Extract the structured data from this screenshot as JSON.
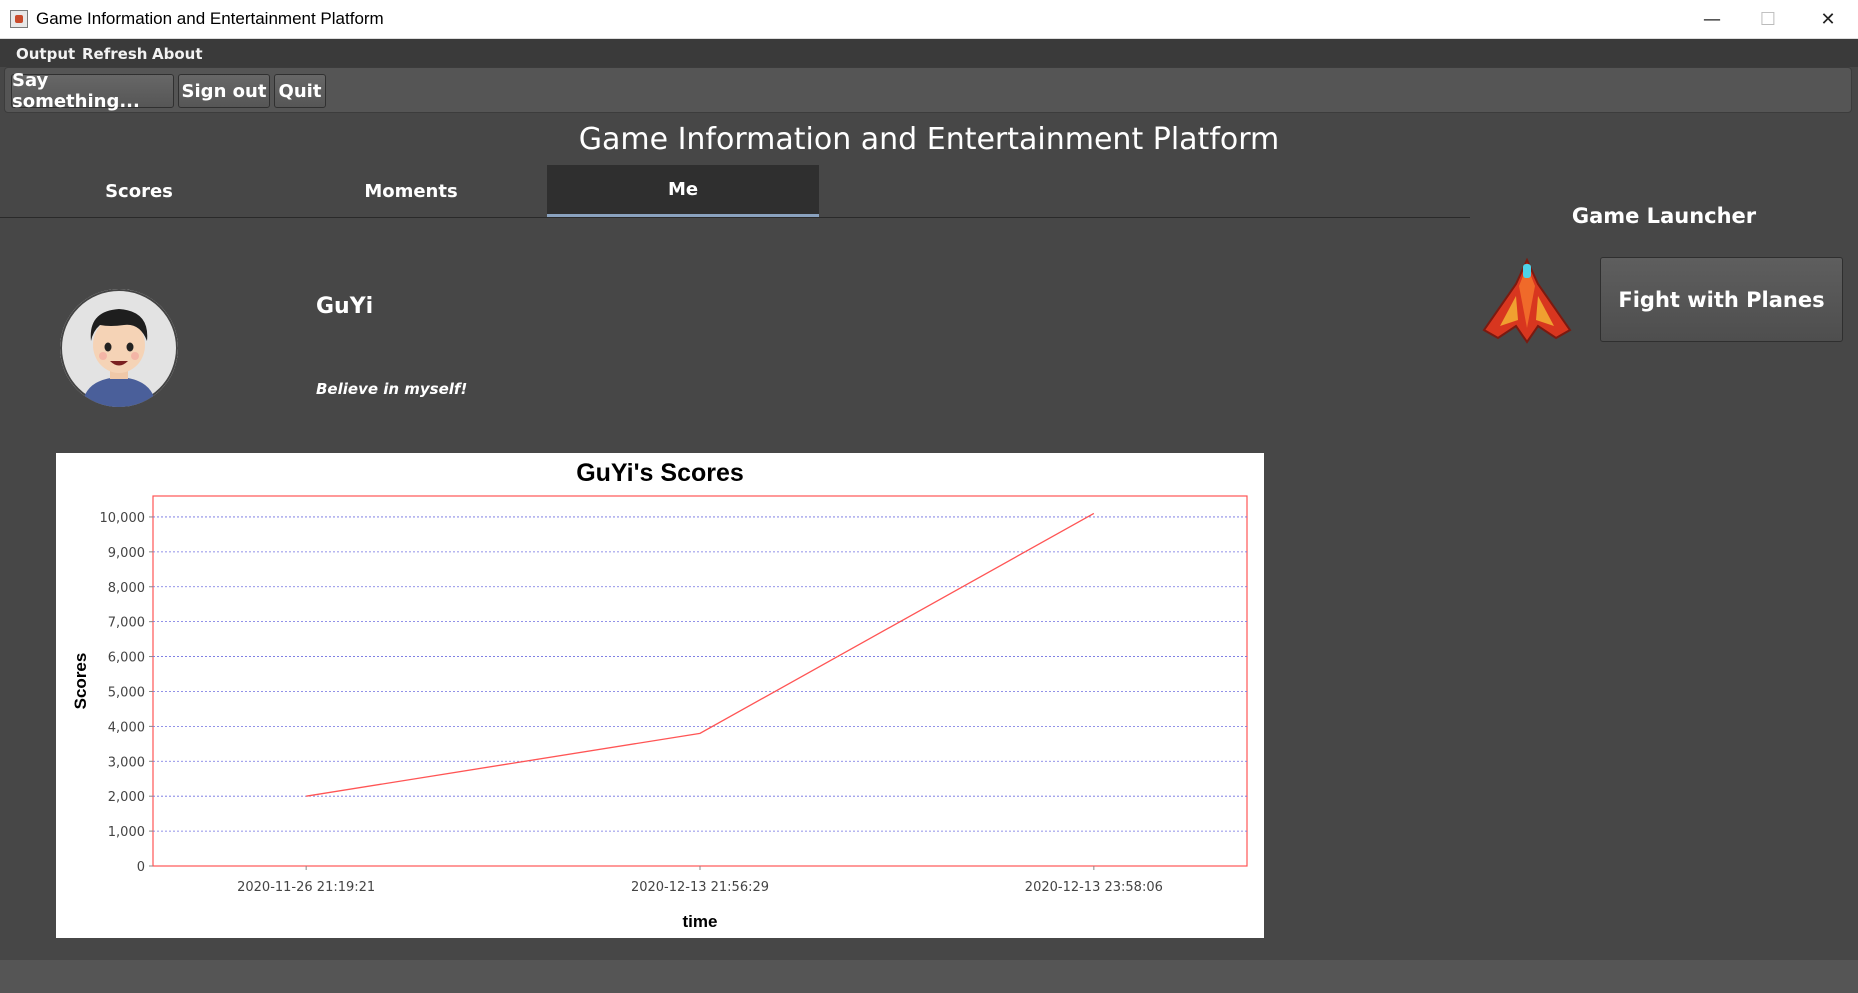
{
  "window": {
    "title": "Game Information and Entertainment Platform"
  },
  "menu": [
    "Output",
    "Refresh",
    "About"
  ],
  "toolbar": {
    "say": "Say something...",
    "signout": "Sign out",
    "quit": "Quit"
  },
  "header": "Game Information and Entertainment Platform",
  "tabs": [
    "Scores",
    "Moments",
    "Me"
  ],
  "active_tab": "Me",
  "profile": {
    "name": "GuYi",
    "motto": "Believe in myself!"
  },
  "launcher": {
    "title": "Game Launcher",
    "game_button": "Fight with Planes"
  },
  "chart_data": {
    "type": "line",
    "title": "GuYi's Scores",
    "xlabel": "time",
    "ylabel": "Scores",
    "x": [
      "2020-11-26 21:19:21",
      "2020-12-13 21:56:29",
      "2020-12-13 23:58:06"
    ],
    "y": [
      2000,
      3800,
      10100
    ],
    "y_ticks": [
      "0",
      "1,000",
      "2,000",
      "3,000",
      "4,000",
      "5,000",
      "6,000",
      "7,000",
      "8,000",
      "9,000",
      "10,000"
    ],
    "ylim": [
      0,
      10600
    ],
    "grid": true,
    "line_color": "#ff5555",
    "grid_color": "#6f6fe0"
  }
}
